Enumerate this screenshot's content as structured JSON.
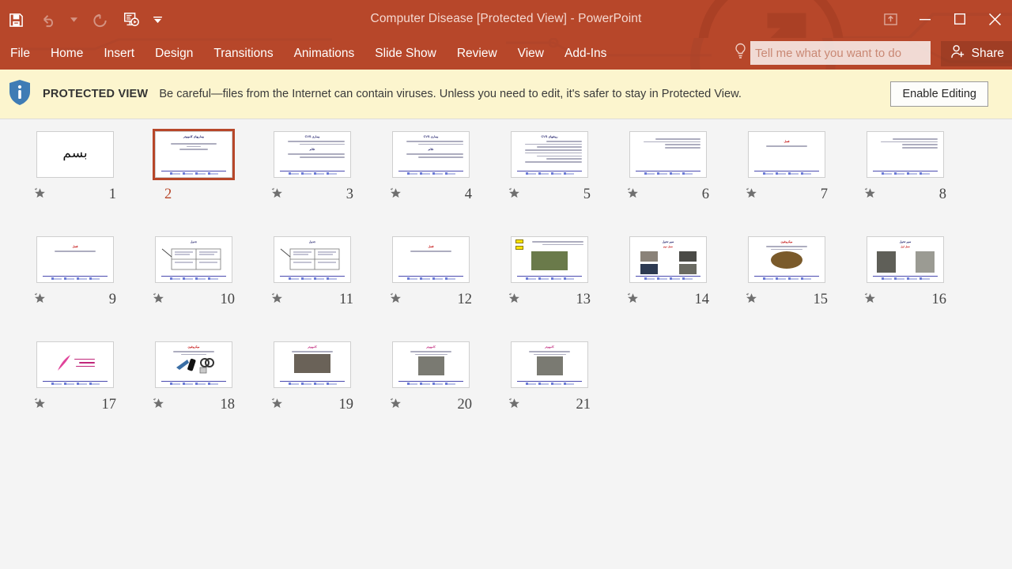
{
  "window": {
    "title": "Computer Disease [Protected View] - PowerPoint",
    "accent_color": "#b7472a",
    "quick_access": [
      {
        "name": "save",
        "icon": "save-icon",
        "enabled": true
      },
      {
        "name": "undo",
        "icon": "undo-icon",
        "enabled": false
      },
      {
        "name": "undo-dropdown",
        "icon": "chevron-down-icon",
        "enabled": false
      },
      {
        "name": "redo",
        "icon": "redo-icon",
        "enabled": false
      },
      {
        "name": "start-presentation",
        "icon": "presentation-icon",
        "enabled": true
      },
      {
        "name": "customize-qat",
        "icon": "chevron-down-icon",
        "enabled": true
      }
    ],
    "controls": [
      {
        "name": "ribbon-display-options",
        "icon": "ribbon-options-icon"
      },
      {
        "name": "minimize",
        "icon": "minimize-icon"
      },
      {
        "name": "restore",
        "icon": "restore-icon"
      },
      {
        "name": "close",
        "icon": "close-icon"
      }
    ]
  },
  "ribbon": {
    "tabs": [
      {
        "label": "File",
        "active": false
      },
      {
        "label": "Home",
        "active": false
      },
      {
        "label": "Insert",
        "active": false
      },
      {
        "label": "Design",
        "active": false
      },
      {
        "label": "Transitions",
        "active": false
      },
      {
        "label": "Animations",
        "active": false
      },
      {
        "label": "Slide Show",
        "active": false
      },
      {
        "label": "Review",
        "active": false
      },
      {
        "label": "View",
        "active": false
      },
      {
        "label": "Add-Ins",
        "active": false
      }
    ],
    "tell_me": {
      "placeholder": "Tell me what you want to do",
      "value": "",
      "icon": "lightbulb-icon"
    },
    "share": {
      "label": "Share",
      "icon": "share-person-icon"
    }
  },
  "protected_view": {
    "icon": "shield-info-icon",
    "label": "PROTECTED VIEW",
    "message": "Be careful—files from the Internet can contain viruses. Unless you need to edit, it's safer to stay in Protected View.",
    "button": "Enable Editing",
    "background_color": "#fcf5ce"
  },
  "slides": {
    "selected": 2,
    "total": 21,
    "rows": [
      [
        {
          "number": "8",
          "star": true,
          "selected": false,
          "kind": "text-right",
          "title": "قلب : برگرفته از این جمله نیز"
        },
        {
          "number": "7",
          "star": true,
          "selected": false,
          "kind": "text-center",
          "title": "صفحه نخست و مقدمه"
        },
        {
          "number": "6",
          "star": true,
          "selected": false,
          "kind": "text-right",
          "title": "کلمه ۲ در نگارگری ها"
        },
        {
          "number": "5",
          "star": true,
          "selected": false,
          "kind": "bullets",
          "title": "روشهای کاهش عوارض CVS"
        },
        {
          "number": "4",
          "star": true,
          "selected": false,
          "kind": "two-block",
          "title": "دلایل ایجاد بیماری"
        },
        {
          "number": "3",
          "star": true,
          "selected": false,
          "kind": "two-block",
          "title": "بیماری CVS"
        },
        {
          "number": "2",
          "star": false,
          "selected": true,
          "kind": "title-slide",
          "title": "بیماریهای کامپیوتر"
        },
        {
          "number": "1",
          "star": true,
          "selected": false,
          "kind": "calligraphy",
          "title": "بسم الله الرحمن الرحیم"
        }
      ],
      [
        {
          "number": "16",
          "star": true,
          "selected": false,
          "kind": "photo-pair",
          "title": "سیر تحولی از کامپیوترهای اولیه تا فعلی"
        },
        {
          "number": "15",
          "star": true,
          "selected": false,
          "kind": "photo-oval",
          "title": "میکروفون"
        },
        {
          "number": "14",
          "star": true,
          "selected": false,
          "kind": "photo-grid",
          "title": "سیر تحولی از کامپیوترهای اولیه تا فعلی"
        },
        {
          "number": "13",
          "star": true,
          "selected": false,
          "kind": "photo-arrows",
          "title": "نمودار مقایسه‌ای"
        },
        {
          "number": "12",
          "star": true,
          "selected": false,
          "kind": "text-center",
          "title": "فصل اول"
        },
        {
          "number": "11",
          "star": true,
          "selected": false,
          "kind": "table",
          "title": "جدول مقایسه ۲۰ درصد"
        },
        {
          "number": "10",
          "star": true,
          "selected": false,
          "kind": "table",
          "title": "جدول مقایسه ۲۰ درصد"
        },
        {
          "number": "9",
          "star": true,
          "selected": false,
          "kind": "text-center",
          "title": "مقایسه کامپیوترهای قدیم و جدید"
        }
      ],
      [
        {
          "number": "",
          "star": false,
          "selected": false,
          "kind": "empty",
          "title": ""
        },
        {
          "number": "",
          "star": false,
          "selected": false,
          "kind": "empty",
          "title": ""
        },
        {
          "number": "",
          "star": false,
          "selected": false,
          "kind": "empty",
          "title": ""
        },
        {
          "number": "21",
          "star": true,
          "selected": false,
          "kind": "photo-tall",
          "title": "کامپیوتر در معماری"
        },
        {
          "number": "20",
          "star": true,
          "selected": false,
          "kind": "photo-tall",
          "title": "کامپیوتر در پزشکی"
        },
        {
          "number": "19",
          "star": true,
          "selected": false,
          "kind": "photo-wide",
          "title": "کامپیوتر در صنعت"
        },
        {
          "number": "18",
          "star": true,
          "selected": false,
          "kind": "photo-obj",
          "title": "میکروفون"
        },
        {
          "number": "17",
          "star": true,
          "selected": false,
          "kind": "logo-pink",
          "title": "نتیجه گیری"
        }
      ]
    ]
  }
}
